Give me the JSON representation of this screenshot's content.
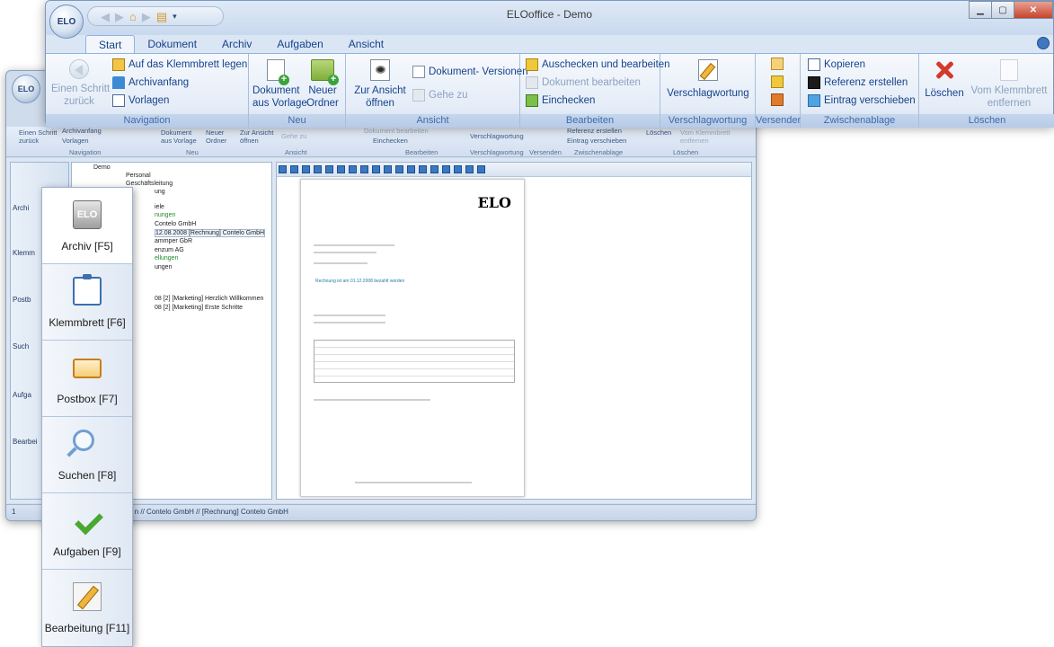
{
  "main": {
    "orb": "ELO",
    "title": "ELOoffice - Demo",
    "tabs": [
      "Start",
      "Dokument",
      "Archiv",
      "Aufgaben",
      "Ansicht"
    ],
    "ribbon": {
      "navigation": {
        "label": "Navigation",
        "back": [
          "Einen Schritt",
          "zurück"
        ],
        "clipboard": "Auf das Klemmbrett legen",
        "archive_start": "Archivanfang",
        "templates": "Vorlagen"
      },
      "neu": {
        "label": "Neu",
        "from_template": [
          "Dokument",
          "aus Vorlage"
        ],
        "new_folder": [
          "Neuer",
          "Ordner"
        ]
      },
      "ansicht": {
        "label": "Ansicht",
        "open_view": [
          "Zur Ansicht",
          "öffnen"
        ],
        "versions": "Dokument- Versionen",
        "goto": "Gehe zu"
      },
      "bearbeiten": {
        "label": "Bearbeiten",
        "checkout_edit": "Auschecken und bearbeiten",
        "edit_doc": "Dokument bearbeiten",
        "checkin": "Einchecken"
      },
      "verschlag": {
        "label": "Verschlagwortung",
        "button": "Verschlagwortung"
      },
      "versenden": {
        "label": "Versenden"
      },
      "zwischenablage": {
        "label": "Zwischenablage",
        "copy": "Kopieren",
        "create_ref": "Referenz erstellen",
        "move_entry": "Eintrag verschieben"
      },
      "loeschen": {
        "label": "Löschen",
        "delete": "Löschen",
        "remove_clip": [
          "Vom Klemmbrett",
          "entfernen"
        ]
      }
    }
  },
  "background": {
    "orb": "ELO",
    "ribbon": {
      "back": [
        "Einen Schritt",
        "zurück"
      ],
      "clip_partial": "Archivanfang",
      "templates": "Vorlagen",
      "from_template": [
        "Dokument",
        "aus Vorlage"
      ],
      "new_folder": [
        "Neuer",
        "Ordner"
      ],
      "open_view": [
        "Zur Ansicht",
        "öffnen"
      ],
      "goto": "Gehe zu",
      "edit_doc": "Dokument bearbeiten",
      "checkin": "Einchecken",
      "verschlag": "Verschlagwortung",
      "create_ref": "Referenz erstellen",
      "move_entry": "Eintrag verschieben",
      "delete": "Löschen",
      "remove_clip": [
        "Vom Klemmbrett",
        "entfernen"
      ],
      "groups": [
        "Navigation",
        "Neu",
        "Ansicht",
        "Bearbeiten",
        "Verschlagwortung",
        "Versenden",
        "Zwischenablage",
        "Löschen"
      ]
    },
    "nav_labels": [
      "Archi",
      "Klemm",
      "Postb",
      "Such",
      "Aufga",
      "Bearbei"
    ],
    "tree": [
      {
        "text": "Demo",
        "cls": ""
      },
      {
        "text": "Personal",
        "cls": ""
      },
      {
        "text": "Geschäftsleitung",
        "cls": ""
      },
      {
        "text": "ung",
        "cls": ""
      },
      {
        "text": "iele",
        "cls": ""
      },
      {
        "text": "nungen",
        "cls": "grn"
      },
      {
        "text": "Contelo GmbH",
        "cls": ""
      },
      {
        "text": "12.08.2008 [Rechnung] Contelo GmbH",
        "cls": "hl"
      },
      {
        "text": "ammper GbR",
        "cls": ""
      },
      {
        "text": "enzum AG",
        "cls": ""
      },
      {
        "text": "ellungen",
        "cls": "grn"
      },
      {
        "text": "ungen",
        "cls": ""
      },
      {
        "text": "08 [2] [Marketing] Herzlich Willkommen",
        "cls": ""
      },
      {
        "text": "08 [2] [Marketing] Erste Schritte",
        "cls": ""
      }
    ],
    "doc": {
      "logo": "ELO",
      "paid": "Rechnung ist am 01.12.2008 bezahlt worden"
    },
    "status": "n // Contelo GmbH // [Rechnung] Contelo GmbH",
    "status_num": "1"
  },
  "flyout": [
    {
      "label": "Archiv [F5]",
      "icon": "archive-icon"
    },
    {
      "label": "Klemmbrett [F6]",
      "icon": "clipboard-icon"
    },
    {
      "label": "Postbox [F7]",
      "icon": "postbox-icon"
    },
    {
      "label": "Suchen [F8]",
      "icon": "search-icon"
    },
    {
      "label": "Aufgaben [F9]",
      "icon": "task-check-icon"
    },
    {
      "label": "Bearbeitung [F11]",
      "icon": "edit-icon"
    }
  ]
}
